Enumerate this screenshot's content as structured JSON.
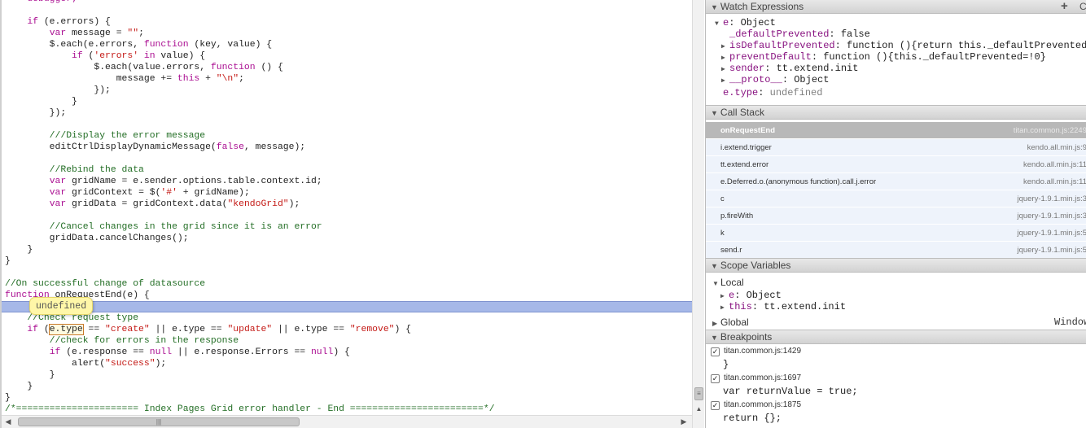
{
  "editor": {
    "hover_tooltip": "undefined",
    "lines": [
      [
        [
          "kw",
          "    debugger;"
        ]
      ],
      [],
      [
        [
          "id",
          "    "
        ],
        [
          "kw",
          "if"
        ],
        [
          "id",
          " (e.errors) {"
        ]
      ],
      [
        [
          "id",
          "        "
        ],
        [
          "kw",
          "var"
        ],
        [
          "id",
          " message = "
        ],
        [
          "str",
          "\"\""
        ],
        [
          "id",
          ";"
        ]
      ],
      [
        [
          "id",
          "        $.each(e.errors, "
        ],
        [
          "kw",
          "function"
        ],
        [
          "id",
          " (key, value) {"
        ]
      ],
      [
        [
          "id",
          "            "
        ],
        [
          "kw",
          "if"
        ],
        [
          "id",
          " ("
        ],
        [
          "str",
          "'errors'"
        ],
        [
          "id",
          " "
        ],
        [
          "kw",
          "in"
        ],
        [
          "id",
          " value) {"
        ]
      ],
      [
        [
          "id",
          "                $.each(value.errors, "
        ],
        [
          "kw",
          "function"
        ],
        [
          "id",
          " () {"
        ]
      ],
      [
        [
          "id",
          "                    message += "
        ],
        [
          "kw",
          "this"
        ],
        [
          "id",
          " + "
        ],
        [
          "str",
          "\"\\n\""
        ],
        [
          "id",
          ";"
        ]
      ],
      [
        [
          "id",
          "                });"
        ]
      ],
      [
        [
          "id",
          "            }"
        ]
      ],
      [
        [
          "id",
          "        });"
        ]
      ],
      [],
      [
        [
          "com",
          "        ///Display the error message"
        ]
      ],
      [
        [
          "id",
          "        editCtrlDisplayDynamicMessage("
        ],
        [
          "kw",
          "false"
        ],
        [
          "id",
          ", message);"
        ]
      ],
      [],
      [
        [
          "com",
          "        //Rebind the data"
        ]
      ],
      [
        [
          "id",
          "        "
        ],
        [
          "kw",
          "var"
        ],
        [
          "id",
          " gridName = e.sender.options.table.context.id;"
        ]
      ],
      [
        [
          "id",
          "        "
        ],
        [
          "kw",
          "var"
        ],
        [
          "id",
          " gridContext = $("
        ],
        [
          "str",
          "'#'"
        ],
        [
          "id",
          " + gridName);"
        ]
      ],
      [
        [
          "id",
          "        "
        ],
        [
          "kw",
          "var"
        ],
        [
          "id",
          " gridData = gridContext.data("
        ],
        [
          "str",
          "\"kendoGrid\""
        ],
        [
          "id",
          ");"
        ]
      ],
      [],
      [
        [
          "com",
          "        //Cancel changes in the grid since it is an error"
        ]
      ],
      [
        [
          "id",
          "        gridData.cancelChanges();"
        ]
      ],
      [
        [
          "id",
          "    }"
        ]
      ],
      [
        [
          "id",
          "}"
        ]
      ],
      [],
      [
        [
          "com",
          "//On successful change of datasource"
        ]
      ],
      [
        [
          "kw",
          "function"
        ],
        [
          "id",
          " onRequestEnd(e) {"
        ]
      ],
      [
        [
          "id",
          ""
        ]
      ],
      [
        [
          "com",
          "    //Check request type"
        ]
      ],
      [
        [
          "id",
          "    "
        ],
        [
          "kw",
          "if"
        ],
        [
          "id",
          " ("
        ],
        [
          "hov",
          "e.type"
        ],
        [
          "id",
          " == "
        ],
        [
          "str",
          "\"create\""
        ],
        [
          "id",
          " || e.type == "
        ],
        [
          "str",
          "\"update\""
        ],
        [
          "id",
          " || e.type == "
        ],
        [
          "str",
          "\"remove\""
        ],
        [
          "id",
          ") {"
        ]
      ],
      [
        [
          "com",
          "        //check for errors in the response"
        ]
      ],
      [
        [
          "id",
          "        "
        ],
        [
          "kw",
          "if"
        ],
        [
          "id",
          " (e.response == "
        ],
        [
          "kw",
          "null"
        ],
        [
          "id",
          " || e.response.Errors == "
        ],
        [
          "kw",
          "null"
        ],
        [
          "id",
          ") {"
        ]
      ],
      [
        [
          "id",
          "            alert("
        ],
        [
          "str",
          "\"success\""
        ],
        [
          "id",
          ");"
        ]
      ],
      [
        [
          "id",
          "        }"
        ]
      ],
      [
        [
          "id",
          "    }"
        ]
      ],
      [
        [
          "id",
          "}"
        ]
      ],
      [
        [
          "com",
          "/*====================== Index Pages Grid error handler - End ========================*/"
        ]
      ]
    ]
  },
  "watch": {
    "title": "Watch Expressions",
    "add_label": "+",
    "root_name": "e",
    "root_value": "Object",
    "props": [
      {
        "toggle": "",
        "name": "_defaultPrevented",
        "value": "false"
      },
      {
        "toggle": "▶",
        "name": "isDefaultPrevented",
        "value": "function (){return this._defaultPrevented=…"
      },
      {
        "toggle": "▶",
        "name": "preventDefault",
        "value": "function (){this._defaultPrevented=!0}"
      },
      {
        "toggle": "▶",
        "name": "sender",
        "value": "tt.extend.init"
      },
      {
        "toggle": "▶",
        "name": "__proto__",
        "value": "Object"
      }
    ],
    "extra_expr": "e.type",
    "extra_value": "undefined"
  },
  "callstack": {
    "title": "Call Stack",
    "frames": [
      {
        "name": "onRequestEnd",
        "file": "titan.common.js:2249"
      },
      {
        "name": "i.extend.trigger",
        "file": "kendo.all.min.js:9"
      },
      {
        "name": "tt.extend.error",
        "file": "kendo.all.min.js:11"
      },
      {
        "name": "e.Deferred.o.(anonymous function).call.j.error",
        "file": "kendo.all.min.js:11"
      },
      {
        "name": "c",
        "file": "jquery-1.9.1.min.js:3"
      },
      {
        "name": "p.fireWith",
        "file": "jquery-1.9.1.min.js:3"
      },
      {
        "name": "k",
        "file": "jquery-1.9.1.min.js:5"
      },
      {
        "name": "send.r",
        "file": "jquery-1.9.1.min.js:5"
      }
    ]
  },
  "scope": {
    "title": "Scope Variables",
    "local_label": "Local",
    "local_vars": [
      {
        "name": "e",
        "value": "Object"
      },
      {
        "name": "this",
        "value": "tt.extend.init"
      }
    ],
    "global_label": "Global",
    "global_value": "Window"
  },
  "breakpoints": {
    "title": "Breakpoints",
    "items": [
      {
        "file": "titan.common.js:1429",
        "code": "}",
        "checked": "✓"
      },
      {
        "file": "titan.common.js:1697",
        "code": "var returnValue = true;",
        "checked": "✓"
      },
      {
        "file": "titan.common.js:1875",
        "code": "return {};",
        "checked": "✓"
      }
    ]
  }
}
